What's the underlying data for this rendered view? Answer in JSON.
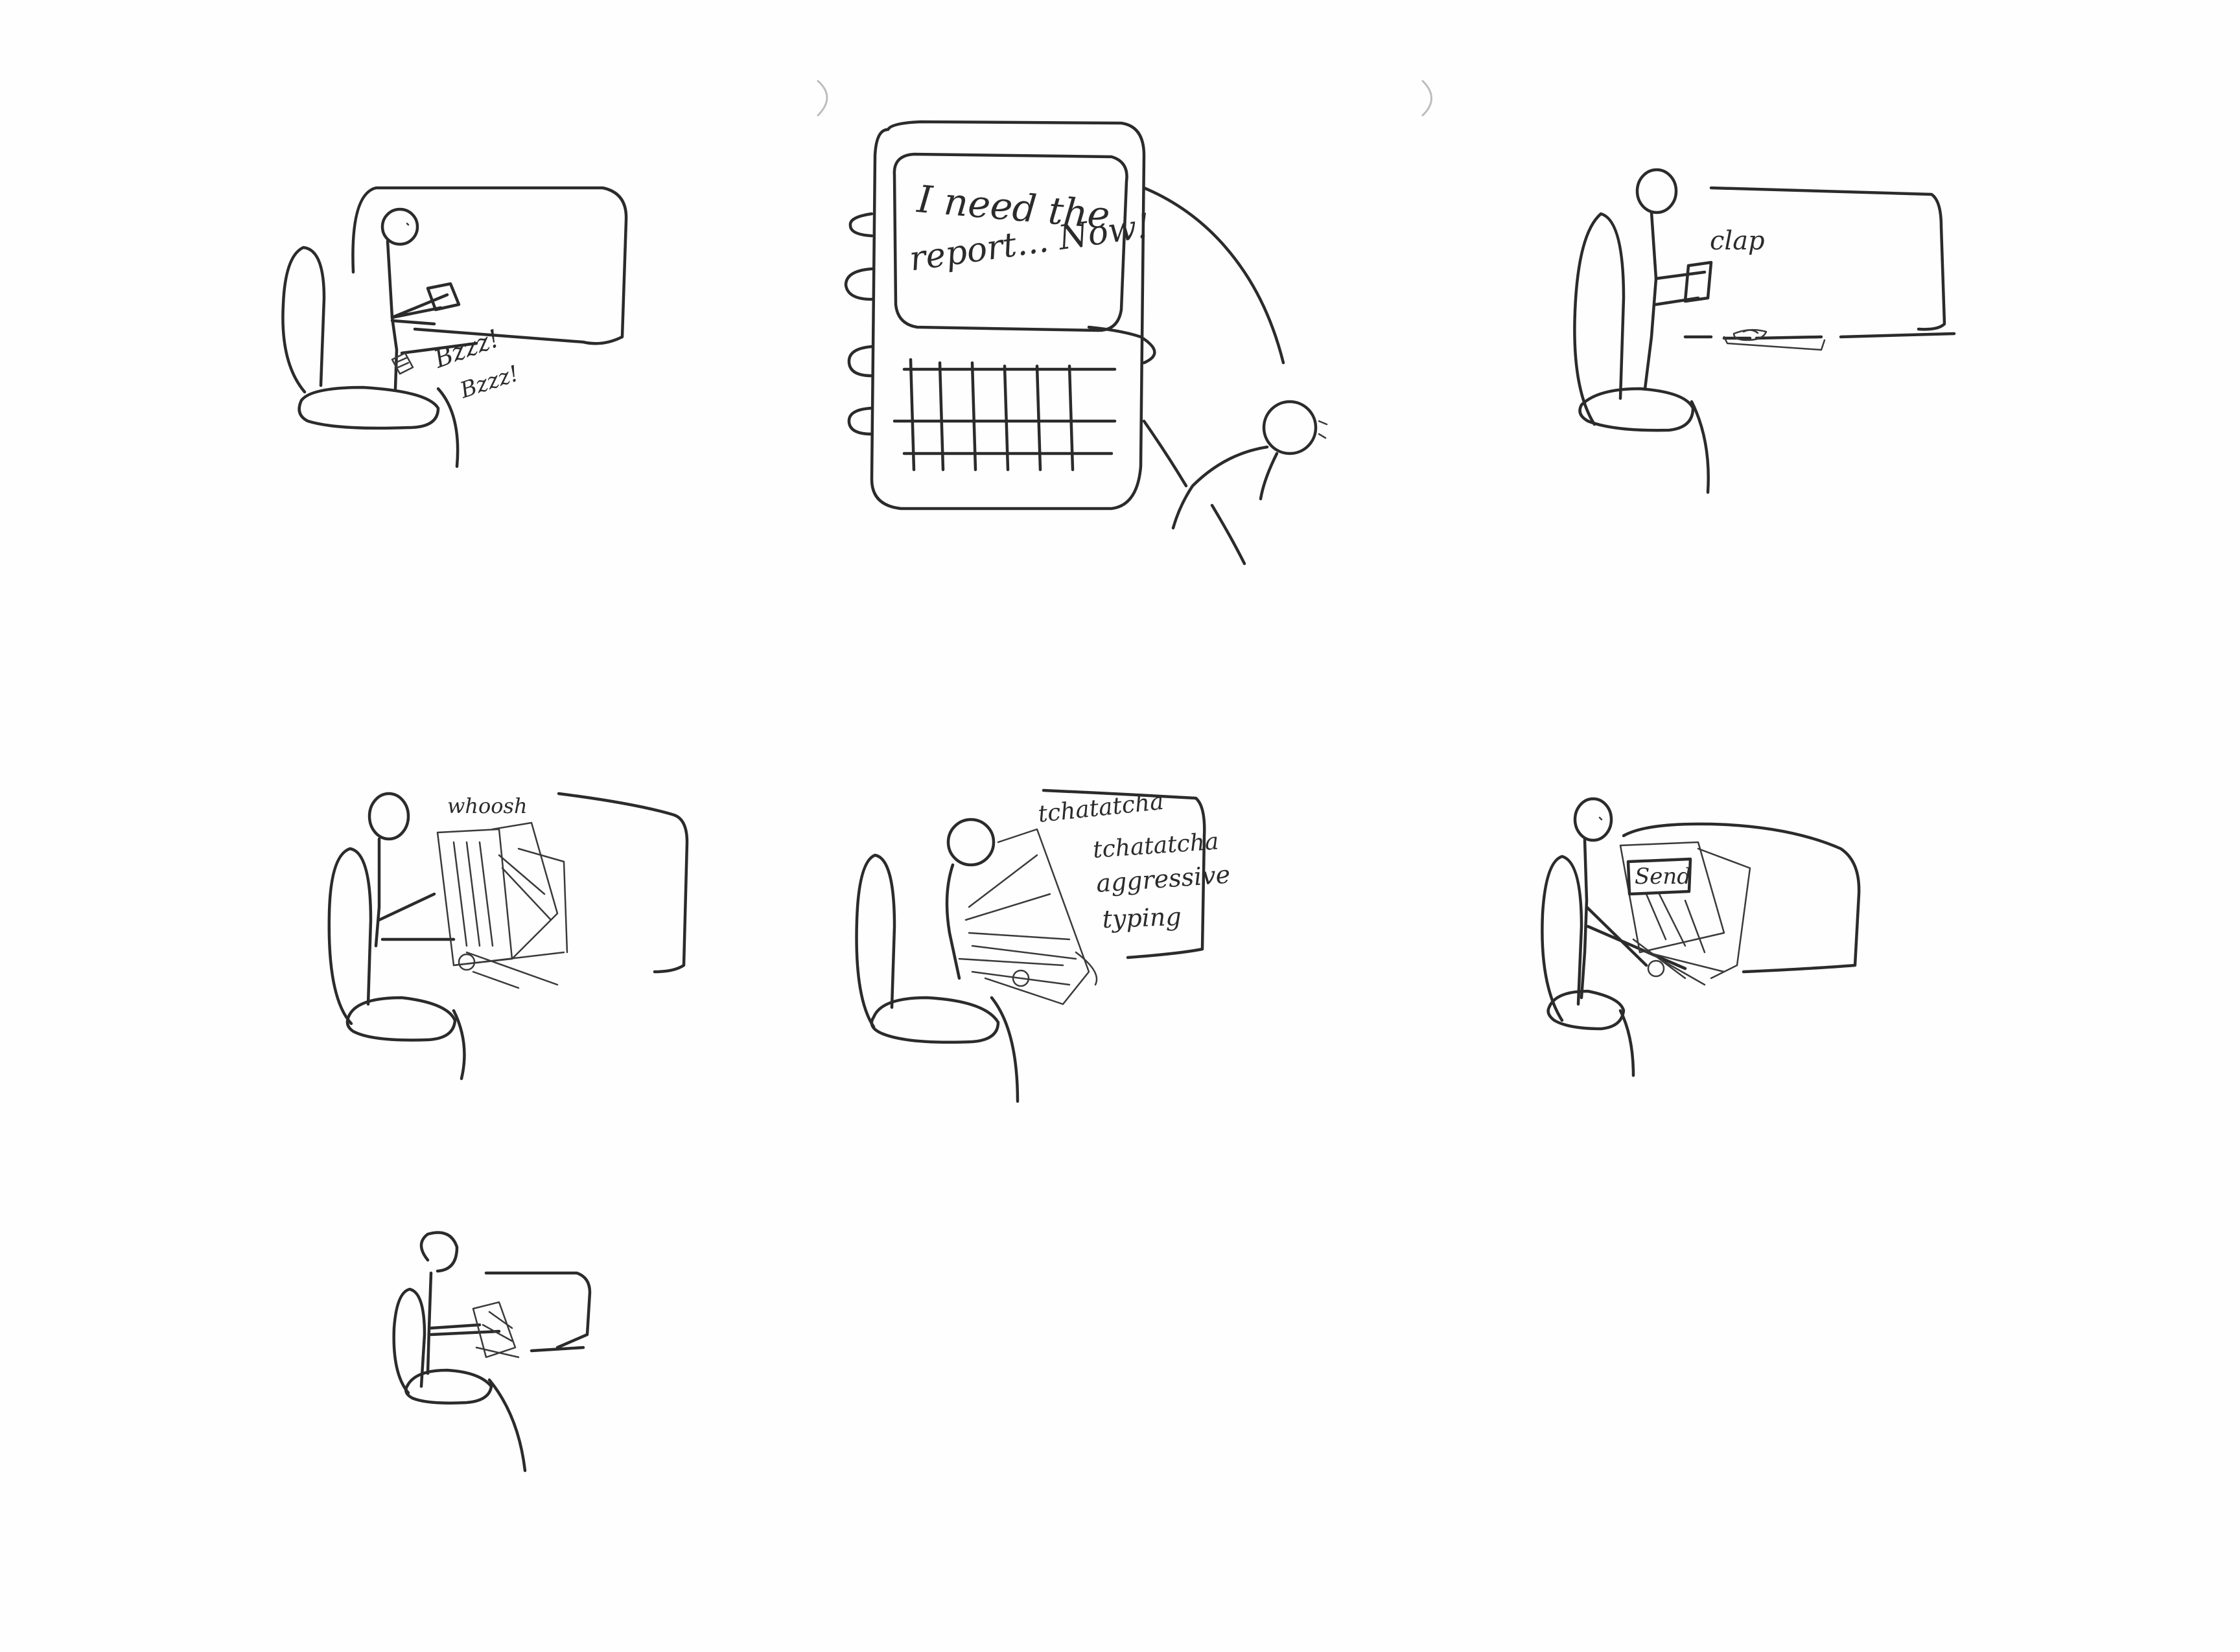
{
  "storyboard": {
    "panels": [
      {
        "id": 1,
        "captions": [
          "Bzzz!",
          "Bzzz!"
        ]
      },
      {
        "id": 2,
        "captions": [
          "I need the",
          "report... Now!"
        ]
      },
      {
        "id": 3,
        "captions": [
          "clap"
        ]
      },
      {
        "id": 4,
        "captions": [
          "whoosh"
        ]
      },
      {
        "id": 5,
        "captions": [
          "tchatatcha",
          "tchatatcha",
          "aggressive",
          "typing"
        ]
      },
      {
        "id": 6,
        "captions": [
          "Send"
        ]
      },
      {
        "id": 7,
        "captions": []
      }
    ]
  }
}
